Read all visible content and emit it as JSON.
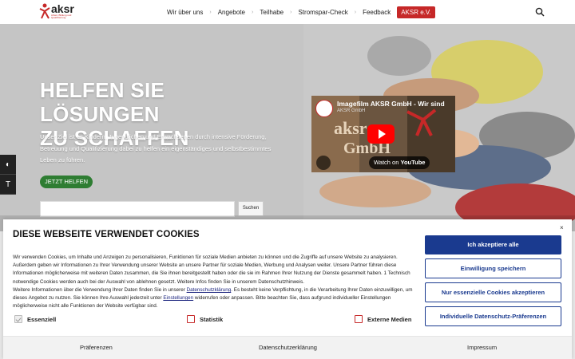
{
  "header": {
    "logo_text": "aksr",
    "logo_sub": "Arbeit, Bildung und Qualifizierung",
    "nav": [
      "Wir über uns",
      "Angebote",
      "Teilhabe",
      "Stromspar-Check",
      "Feedback"
    ],
    "nav_button": "AKSR e.V."
  },
  "hero": {
    "title_line1": "HELFEN SIE LÖSUNGEN",
    "title_line2": "ZU SCHAFFEN",
    "text": "Unser Ziel ist es Kindern, Jugendlichen und Erwachsenen durch intensive Förderung, Betreuung und Qualifizierung dabei zu helfen ein eigenständiges und selbstbestimmtes Leben zu führen.",
    "cta": "JETZT HELFEN",
    "search_placeholder": "",
    "search_button": "Suchen"
  },
  "video": {
    "title": "Imagefilm AKSR GmbH - Wir sind",
    "channel": "AKSR GmbH",
    "watch_on": "Watch on",
    "platform": "YouTube",
    "overlay_text": "aksr GmbH"
  },
  "cookie": {
    "title": "DIESE WEBSEITE VERWENDET COOKIES",
    "paragraph1": "Wir verwenden Cookies, um Inhalte und Anzeigen zu personalisieren, Funktionen für soziale Medien anbieten zu können und die Zugriffe auf unsere Website zu analysieren. Außerdem geben wir Informationen zu Ihrer Verwendung unserer Website an unsere Partner für soziale Medien, Werbung und Analysen weiter. Unsere Partner führen diese Informationen möglicherweise mit weiteren Daten zusammen, die Sie ihnen bereitgestellt haben oder die sie im Rahmen Ihrer Nutzung der Dienste gesammelt haben. 1 Technisch notwendige Cookies werden auch bei der Auswahl von ablehnen gesetzt. Weitere Infos finden Sie in unserem Datenschutzhinweis.",
    "paragraph2_a": "Weitere Informationen über die Verwendung Ihrer Daten finden Sie in unserer ",
    "paragraph2_link1": "Datenschutzklärung",
    "paragraph2_b": ". Es besteht keine Verpflichtung, in die Verarbeitung Ihrer Daten einzuwilligen, um dieses Angebot zu nutzen. Sie können Ihre Auswahl jederzeit unter ",
    "paragraph2_link2": "Einstellungen",
    "paragraph2_c": " widerrufen oder anpassen. Bitte beachten Sie, dass aufgrund individueller Einstellungen möglicherweise nicht alle Funktionen der Website verfügbar sind.",
    "checks": [
      "Essenziell",
      "Statistik",
      "Externe Medien"
    ],
    "buttons": {
      "accept_all": "Ich akzeptiere alle",
      "consent_save": "Einwilligung speichern",
      "only_essential": "Nur essenzielle Cookies akzeptieren",
      "individual": "Individuelle Datenschutz-Präferenzen"
    },
    "footer": [
      "Präferenzen",
      "Datenschutzerklärung",
      "Impressum"
    ],
    "close": "×"
  },
  "colors": {
    "brand_red": "#c62828",
    "cta_green": "#2e7d32",
    "cookie_blue": "#1a3a8f"
  }
}
